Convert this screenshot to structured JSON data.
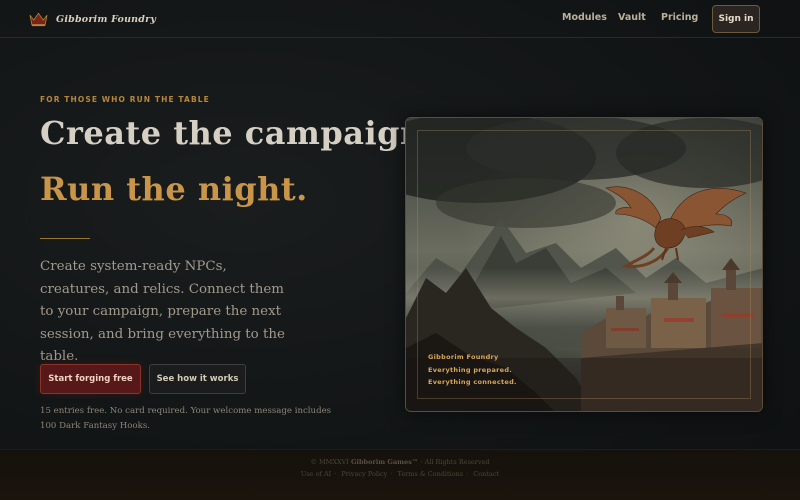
{
  "nav": {
    "brand": "Gibborim Foundry",
    "links": [
      "Modules",
      "Vault",
      "Pricing"
    ],
    "signin": "Sign in"
  },
  "hero": {
    "eyebrow": "FOR THOSE WHO RUN THE TABLE",
    "headline_line1": "Create the campaign.",
    "headline_line2": "Run the night.",
    "lead": "Create system-ready NPCs, creatures, and relics. Connect them to your campaign, prepare the next session, and bring everything to the table.",
    "primary_cta": "Start forging free",
    "secondary_cta": "See how it works",
    "fine_print": "15 entries free. No card required. Your welcome message includes 100 Dark Fantasy Hooks."
  },
  "art": {
    "caption_title": "Gibborim Foundry",
    "caption_line1": "Everything prepared.",
    "caption_line2": "Everything connected."
  },
  "footer": {
    "copyright_prefix": "© MMXXVI",
    "copyright_name": "Gibborim Games™",
    "copyright_suffix": "· All Rights Reserved",
    "links": [
      "Use of AI",
      "Privacy Policy",
      "Terms & Conditions",
      "Contact"
    ]
  },
  "colors": {
    "accent_gold": "#c99548",
    "primary_red": "#561818",
    "background": "#121516"
  }
}
